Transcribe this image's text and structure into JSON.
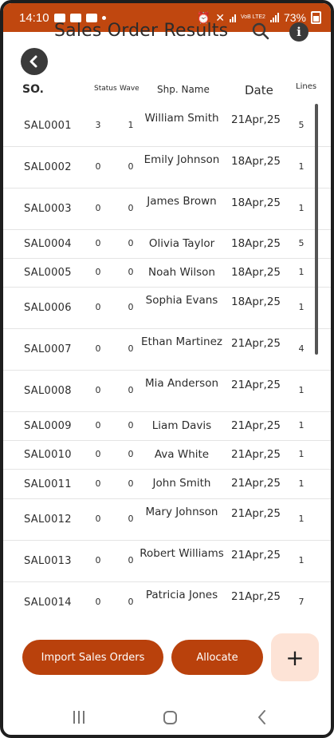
{
  "status_bar": {
    "time": "14:10",
    "battery": "73%",
    "network": "VoB LTE2"
  },
  "header": {
    "title": "Sales Order Results"
  },
  "columns": {
    "so": "SO.",
    "status": "Status",
    "wave": "Wave",
    "name": "Shp. Name",
    "date": "Date",
    "lines": "Lines"
  },
  "orders": [
    {
      "so": "SAL0001",
      "status": "3",
      "wave": "1",
      "name": "William Smith",
      "date": "21Apr,25",
      "lines": "5"
    },
    {
      "so": "SAL0002",
      "status": "0",
      "wave": "0",
      "name": "Emily Johnson",
      "date": "18Apr,25",
      "lines": "1"
    },
    {
      "so": "SAL0003",
      "status": "0",
      "wave": "0",
      "name": "James Brown",
      "date": "18Apr,25",
      "lines": "1"
    },
    {
      "so": "SAL0004",
      "status": "0",
      "wave": "0",
      "name": "Olivia Taylor",
      "date": "18Apr,25",
      "lines": "5"
    },
    {
      "so": "SAL0005",
      "status": "0",
      "wave": "0",
      "name": "Noah Wilson",
      "date": "18Apr,25",
      "lines": "1"
    },
    {
      "so": "SAL0006",
      "status": "0",
      "wave": "0",
      "name": "Sophia Evans",
      "date": "18Apr,25",
      "lines": "1"
    },
    {
      "so": "SAL0007",
      "status": "0",
      "wave": "0",
      "name": "Ethan Martinez",
      "date": "21Apr,25",
      "lines": "4"
    },
    {
      "so": "SAL0008",
      "status": "0",
      "wave": "0",
      "name": "Mia Anderson",
      "date": "21Apr,25",
      "lines": "1"
    },
    {
      "so": "SAL0009",
      "status": "0",
      "wave": "0",
      "name": "Liam Davis",
      "date": "21Apr,25",
      "lines": "1"
    },
    {
      "so": "SAL0010",
      "status": "0",
      "wave": "0",
      "name": "Ava White",
      "date": "21Apr,25",
      "lines": "1"
    },
    {
      "so": "SAL0011",
      "status": "0",
      "wave": "0",
      "name": "John Smith",
      "date": "21Apr,25",
      "lines": "1"
    },
    {
      "so": "SAL0012",
      "status": "0",
      "wave": "0",
      "name": "Mary Johnson",
      "date": "21Apr,25",
      "lines": "1"
    },
    {
      "so": "SAL0013",
      "status": "0",
      "wave": "0",
      "name": "Robert Williams",
      "date": "21Apr,25",
      "lines": "1"
    },
    {
      "so": "SAL0014",
      "status": "0",
      "wave": "0",
      "name": "Patricia Jones",
      "date": "21Apr,25",
      "lines": "7"
    }
  ],
  "actions": {
    "import": "Import Sales Orders",
    "allocate": "Allocate",
    "add": "+"
  },
  "colors": {
    "accent": "#c0470f",
    "button": "#b9410c",
    "add_bg": "#fde3d6",
    "text": "#2c2c2c"
  },
  "icons": {
    "back": "back-arrow-icon",
    "search": "search-icon",
    "info": "info-icon"
  }
}
